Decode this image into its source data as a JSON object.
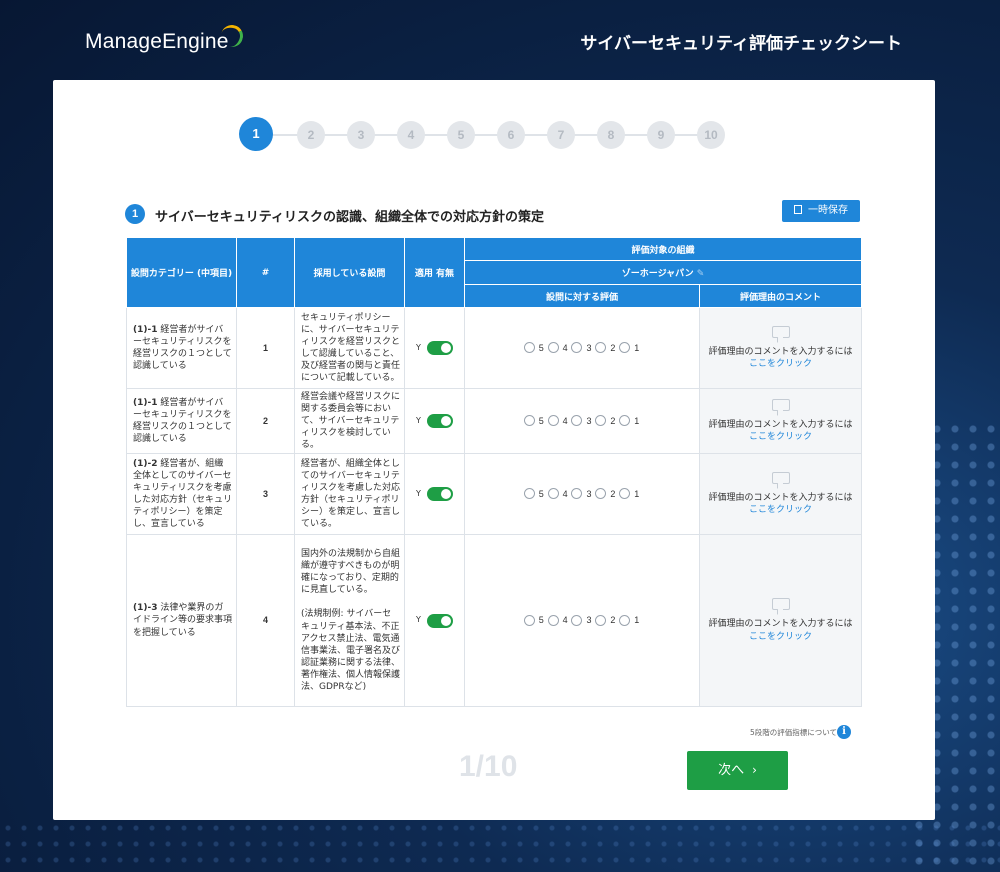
{
  "brand": {
    "logo": "ManageEngine",
    "title": "サイバーセキュリティ評価チェックシート"
  },
  "steps": [
    "1",
    "2",
    "3",
    "4",
    "5",
    "6",
    "7",
    "8",
    "9",
    "10"
  ],
  "active_step": 1,
  "section": {
    "number": "1",
    "title": "サイバーセキュリティリスクの認識、組織全体での対応方針の策定",
    "save_label": "一時保存"
  },
  "table": {
    "headers": {
      "category": "設問カテゴリー (中項目)",
      "num": "#",
      "measure": "採用している設問",
      "applicable": "適用 有無",
      "org_group": "評価対象の組織",
      "org_name": "ゾーホージャパン",
      "evaluation": "設問に対する評価",
      "comment": "評価理由のコメント"
    },
    "rating_labels": [
      "5",
      "4",
      "3",
      "2",
      "1"
    ],
    "toggle_label": "Y",
    "comment_prompt": "評価理由のコメントを入力するには",
    "comment_link": "ここをクリック",
    "rows": [
      {
        "category_code": "(1)-1",
        "category_text": "経営者がサイバーセキュリティリスクを経営リスクの１つとして認識している",
        "num": "1",
        "measure": "セキュリティポリシーに、サイバーセキュリティリスクを経営リスクとして認識していること、及び経営者の関与と責任について記載している。"
      },
      {
        "category_code": "(1)-1",
        "category_text": "経営者がサイバーセキュリティリスクを経営リスクの１つとして認識している",
        "num": "2",
        "measure": "経営会議や経営リスクに関する委員会等において、サイバーセキュリティリスクを検討している。"
      },
      {
        "category_code": "(1)-2",
        "category_text": "経営者が、組織全体としてのサイバーセキュリティリスクを考慮した対応方針（セキュリティポリシー）を策定し、宣言している",
        "num": "3",
        "measure": "経営者が、組織全体としてのサイバーセキュリティリスクを考慮した対応方針（セキュリティポリシー）を策定し、宣言している。"
      },
      {
        "category_code": "(1)-3",
        "category_text": "法律や業界のガイドライン等の要求事項を把握している",
        "num": "4",
        "measure": "国内外の法規制から自組織が遵守すべきものが明確になっており、定期的に見直している。",
        "measure_note": "(法規制例: サイバーセキュリティ基本法、不正アクセス禁止法、電気通信事業法、電子署名及び認証業務に関する法律、著作権法、個人情報保護法、GDPRなど)"
      }
    ]
  },
  "footer": {
    "hint": "5段階の評価指標について",
    "info_icon": "i",
    "pager": "1/10",
    "next_label": "次へ",
    "next_chevron": "›"
  }
}
